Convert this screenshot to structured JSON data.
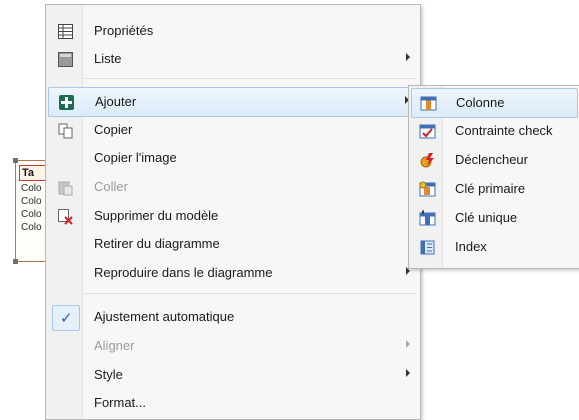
{
  "diagram_table": {
    "header": "Ta",
    "columns": [
      "Colo",
      "Colo",
      "Colo",
      "Colo"
    ]
  },
  "menu": {
    "items": [
      {
        "label": "Propriétés",
        "icon": "properties-grid-icon"
      },
      {
        "label": "Liste",
        "icon": "list-icon",
        "has_submenu": true
      },
      {
        "label": "Ajouter",
        "icon": "add-icon",
        "has_submenu": true,
        "highlighted": true
      },
      {
        "label": "Copier",
        "icon": "copy-icon"
      },
      {
        "label": "Copier l'image"
      },
      {
        "label": "Coller",
        "icon": "paste-icon",
        "disabled": true
      },
      {
        "label": "Supprimer du modèle",
        "icon": "delete-icon"
      },
      {
        "label": "Retirer du diagramme"
      },
      {
        "label": "Reproduire dans le diagramme",
        "has_submenu": true
      },
      {
        "label": "Ajustement automatique",
        "checked": true
      },
      {
        "label": "Aligner",
        "has_submenu": true,
        "disabled": true
      },
      {
        "label": "Style",
        "has_submenu": true
      },
      {
        "label": "Format..."
      }
    ]
  },
  "submenu": {
    "items": [
      {
        "label": "Colonne",
        "icon": "column-icon",
        "highlighted": true
      },
      {
        "label": "Contrainte check",
        "icon": "check-constraint-icon"
      },
      {
        "label": "Déclencheur",
        "icon": "trigger-icon"
      },
      {
        "label": "Clé primaire",
        "icon": "primary-key-icon"
      },
      {
        "label": "Clé unique",
        "icon": "unique-key-icon"
      },
      {
        "label": "Index",
        "icon": "index-icon"
      }
    ]
  },
  "colors": {
    "hover_border": "#a9c8ea",
    "check": "#2b5dbd",
    "disabled_text": "#9b9b9b"
  }
}
